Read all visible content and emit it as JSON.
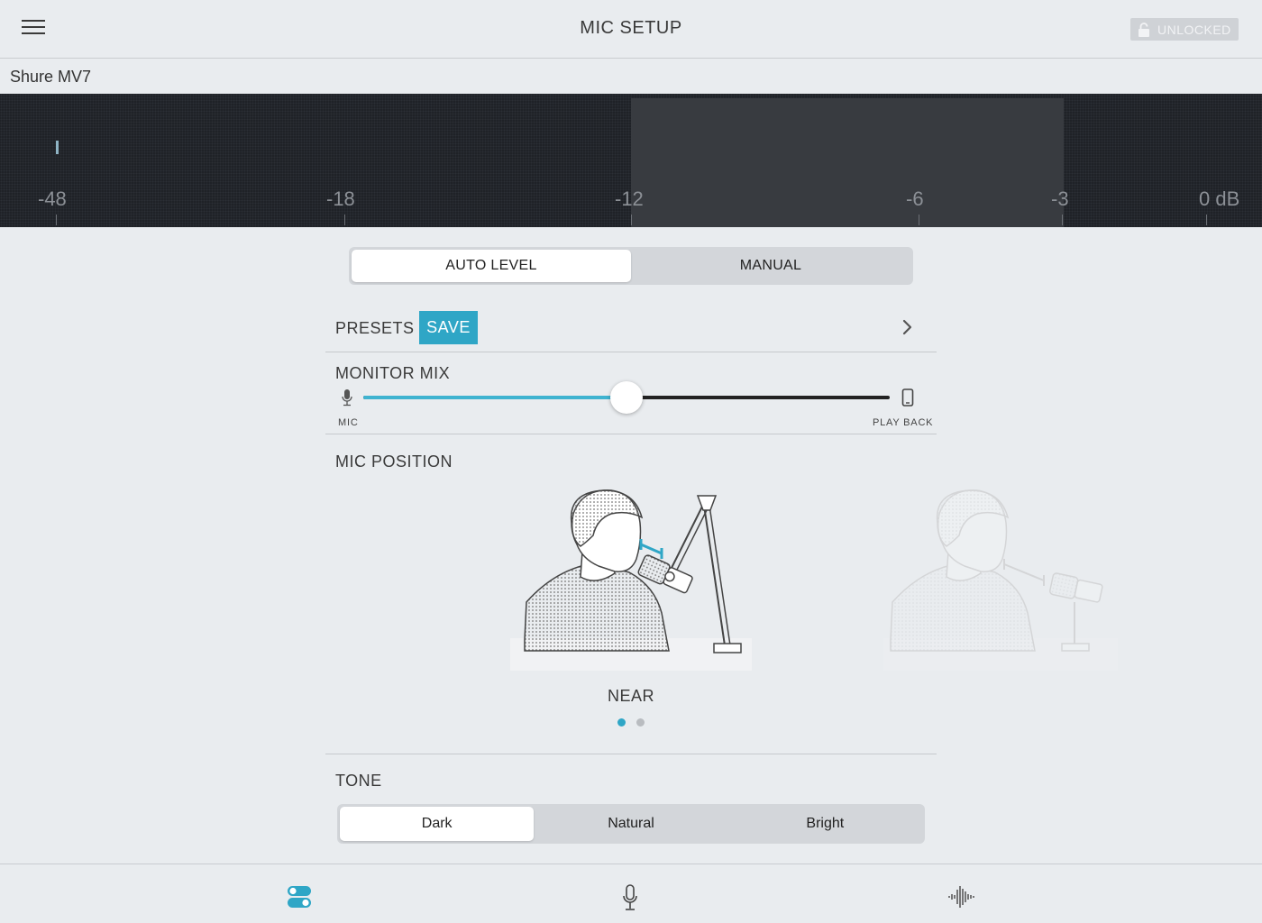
{
  "header": {
    "title": "MIC SETUP",
    "lock_label": "UNLOCKED"
  },
  "device": {
    "name": "Shure MV7"
  },
  "meter": {
    "scale": [
      "-48",
      "-18",
      "-12",
      "-6",
      "-3",
      "0 dB"
    ],
    "target_zone": [
      "-12",
      "-3"
    ]
  },
  "mode": {
    "options": [
      "AUTO LEVEL",
      "MANUAL"
    ],
    "selected": "AUTO LEVEL"
  },
  "presets": {
    "label": "PRESETS",
    "save_label": "SAVE"
  },
  "monitor_mix": {
    "label": "MONITOR MIX",
    "left_label": "MIC",
    "right_label": "PLAY BACK",
    "value": 0.5
  },
  "mic_position": {
    "label": "MIC POSITION",
    "current": "NEAR",
    "page_count": 2,
    "page_index": 0
  },
  "tone": {
    "label": "TONE",
    "options": [
      "Dark",
      "Natural",
      "Bright"
    ],
    "selected": "Dark"
  },
  "tabs": [
    {
      "icon": "toggles-icon",
      "active": true
    },
    {
      "icon": "microphone-icon",
      "active": false
    },
    {
      "icon": "waveform-icon",
      "active": false
    }
  ],
  "colors": {
    "accent": "#2fa6c6",
    "background": "#e9ecef",
    "meter_bg": "#1f2227"
  }
}
